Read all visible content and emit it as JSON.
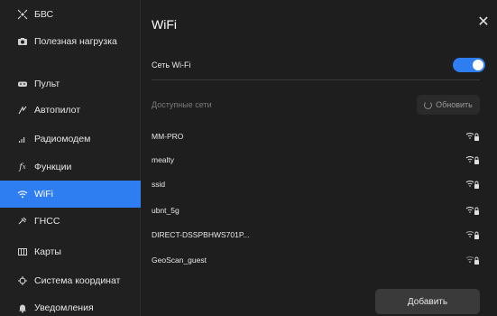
{
  "sidebar": {
    "items": [
      {
        "label": "БВС",
        "icon": "drone-icon"
      },
      {
        "label": "Полезная нагрузка",
        "icon": "camera-icon"
      },
      {
        "label": "Пульт",
        "icon": "gamepad-icon"
      },
      {
        "label": "Автопилот",
        "icon": "autopilot-icon"
      },
      {
        "label": "Радиомодем",
        "icon": "signal-bars-icon"
      },
      {
        "label": "Функции",
        "icon": "function-icon"
      },
      {
        "label": "WiFi",
        "icon": "wifi-icon"
      },
      {
        "label": "ГНСС",
        "icon": "satellite-icon"
      },
      {
        "label": "Карты",
        "icon": "map-icon"
      },
      {
        "label": "Система координат",
        "icon": "crosshair-icon"
      },
      {
        "label": "Уведомления",
        "icon": "bell-icon"
      }
    ],
    "active": "WiFi"
  },
  "main": {
    "title": "WiFi",
    "close_symbol": "✕",
    "wifi_toggle_label": "Сеть Wi-Fi",
    "wifi_enabled": true,
    "available_label": "Доступные сети",
    "refresh_label": "Обновить",
    "networks": [
      {
        "name": "MM-PRO",
        "locked": true
      },
      {
        "name": "mealty",
        "locked": true
      },
      {
        "name": "ssid",
        "locked": true
      },
      {
        "name": "ubnt_5g",
        "locked": true
      },
      {
        "name": "DIRECT-DSSPBHWS701P...",
        "locked": true
      },
      {
        "name": "GeoScan_guest",
        "locked": true
      }
    ],
    "add_label": "Добавить"
  },
  "colors": {
    "accent": "#2f7ef1",
    "background": "#1e1e1e",
    "sidebar": "#202020"
  }
}
